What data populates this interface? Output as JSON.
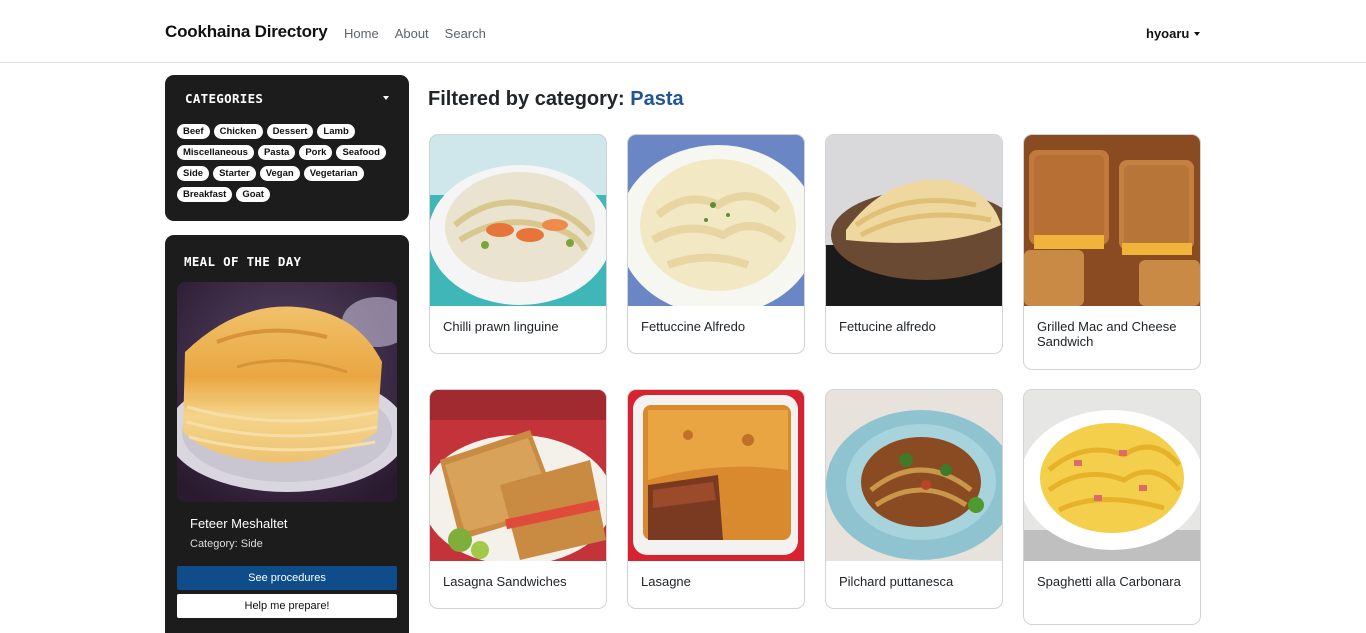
{
  "navbar": {
    "brand": "Cookhaina Directory",
    "links": [
      "Home",
      "About",
      "Search"
    ],
    "user": "hyoaru"
  },
  "categories_panel": {
    "title": "CATEGORIES",
    "items": [
      "Beef",
      "Chicken",
      "Dessert",
      "Lamb",
      "Miscellaneous",
      "Pasta",
      "Pork",
      "Seafood",
      "Side",
      "Starter",
      "Vegan",
      "Vegetarian",
      "Breakfast",
      "Goat"
    ]
  },
  "meal_of_the_day": {
    "title": "MEAL OF THE DAY",
    "name": "Feteer Meshaltet",
    "category": "Category: Side",
    "see_procedures": "See procedures",
    "help_prepare": "Help me prepare!"
  },
  "main": {
    "heading_prefix": "Filtered by category:",
    "heading_category": "Pasta",
    "meals": [
      "Chilli prawn linguine",
      "Fettuccine Alfredo",
      "Fettucine alfredo",
      "Grilled Mac and Cheese Sandwich",
      "Lasagna Sandwiches",
      "Lasagne",
      "Pilchard puttanesca",
      "Spaghetti alla Carbonara"
    ]
  },
  "colors": {
    "panel_bg": "#1c1c1c",
    "accent_blue": "#0f4c8a",
    "heading_category": "#1f5594"
  }
}
